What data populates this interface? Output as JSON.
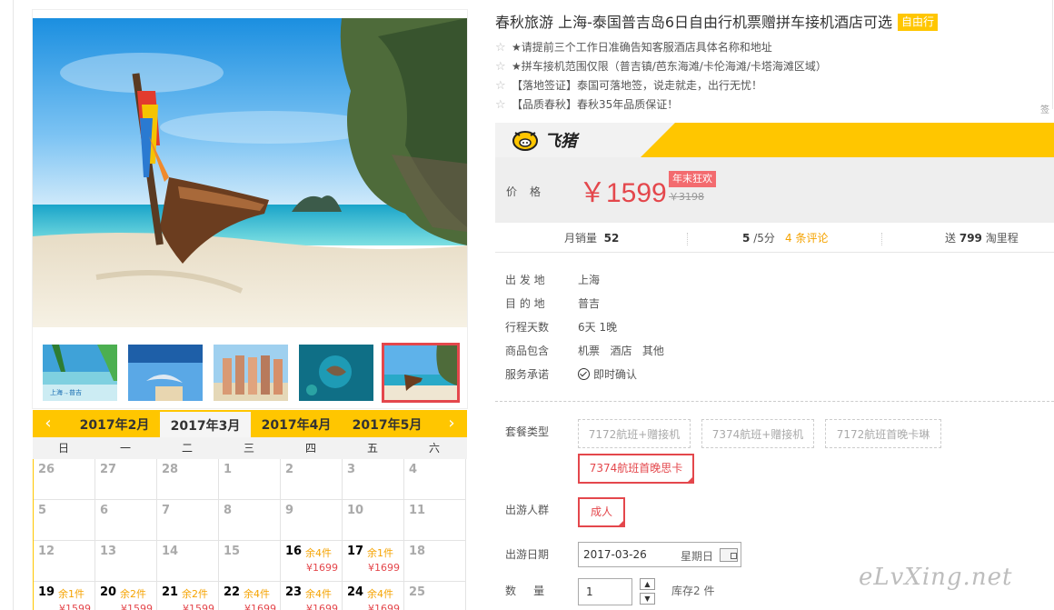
{
  "product": {
    "title": "春秋旅游 上海-泰国普吉岛6日自由行机票赠拼车接机酒店可选",
    "type_tag": "自由行",
    "notes": [
      "★请提前三个工作日准确告知客服酒店具体名称和地址",
      "★拼车接机范围仅限（普吉镇/芭东海滩/卡伦海滩/卡塔海滩区域）",
      "【落地签证】泰国可落地签，说走就走，出行无忧！",
      "【品质春秋】春秋35年品质保证！"
    ],
    "edge_char": "签"
  },
  "brand": {
    "name": "飞猪"
  },
  "price": {
    "label": "价格",
    "current": "￥1599",
    "promo_tag": "年末狂欢",
    "original": "￥3198"
  },
  "stats": {
    "sales_label": "月销量",
    "sales_value": "52",
    "rating_value": "5",
    "rating_suffix": "/5分",
    "reviews": "4 条评论",
    "points_prefix": "送",
    "points_value": "799",
    "points_suffix": "淘里程"
  },
  "info": [
    {
      "key": "出 发 地",
      "value": "上海"
    },
    {
      "key": "目 的 地",
      "value": "普吉"
    },
    {
      "key": "行程天数",
      "value": "6天 1晚"
    },
    {
      "key": "商品包含",
      "value": "机票   酒店   其他"
    },
    {
      "key": "服务承诺",
      "value": "即时确认"
    }
  ],
  "package": {
    "label": "套餐类型",
    "options": [
      "7172航班+赠接机",
      "7374航班+赠接机",
      "7172航班首晚卡琳",
      "7374航班首晚思卡"
    ],
    "selected": "7374航班首晚思卡"
  },
  "traveler": {
    "label": "出游人群",
    "option": "成人"
  },
  "departure": {
    "label": "出游日期",
    "date": "2017-03-26",
    "weekday": "星期日"
  },
  "quantity": {
    "label": "数     量",
    "value": "1",
    "stock": "库存2 件"
  },
  "calendar": {
    "months": [
      "2017年2月",
      "2017年3月",
      "2017年4月",
      "2017年5月"
    ],
    "active_month": "2017年3月",
    "weekdays": [
      "日",
      "一",
      "二",
      "三",
      "四",
      "五",
      "六"
    ],
    "rows": [
      [
        {
          "d": "26"
        },
        {
          "d": "27"
        },
        {
          "d": "28"
        },
        {
          "d": "1"
        },
        {
          "d": "2"
        },
        {
          "d": "3"
        },
        {
          "d": "4"
        }
      ],
      [
        {
          "d": "5"
        },
        {
          "d": "6"
        },
        {
          "d": "7"
        },
        {
          "d": "8"
        },
        {
          "d": "9"
        },
        {
          "d": "10"
        },
        {
          "d": "11"
        }
      ],
      [
        {
          "d": "12"
        },
        {
          "d": "13"
        },
        {
          "d": "14"
        },
        {
          "d": "15"
        },
        {
          "d": "16",
          "left": "余4件",
          "price": "¥1699"
        },
        {
          "d": "17",
          "left": "余1件",
          "price": "¥1699"
        },
        {
          "d": "18"
        }
      ],
      [
        {
          "d": "19",
          "left": "余1件",
          "price": "¥1599"
        },
        {
          "d": "20",
          "left": "余2件",
          "price": "¥1599"
        },
        {
          "d": "21",
          "left": "余2件",
          "price": "¥1599"
        },
        {
          "d": "22",
          "left": "余4件",
          "price": "¥1699"
        },
        {
          "d": "23",
          "left": "余4件",
          "price": "¥1699"
        },
        {
          "d": "24",
          "left": "余4件",
          "price": "¥1699"
        },
        {
          "d": "25"
        }
      ]
    ]
  },
  "thumbnails": [
    "上海→普吉"
  ],
  "watermark": "eLvXing.net",
  "colors": {
    "accent": "#ffc600",
    "price": "#e4474c",
    "orange": "#f5a300"
  }
}
